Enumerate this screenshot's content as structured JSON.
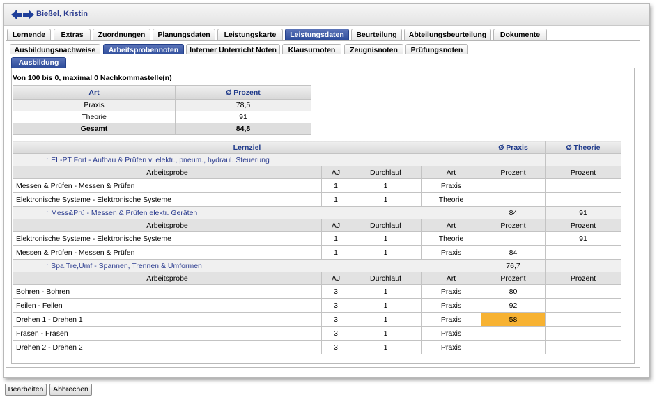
{
  "window": {
    "title": "Bießel, Kristin"
  },
  "tabs_main": [
    {
      "label": "Lernende",
      "active": false
    },
    {
      "label": "Extras",
      "active": false
    },
    {
      "label": "Zuordnungen",
      "active": false
    },
    {
      "label": "Planungsdaten",
      "active": false
    },
    {
      "label": "Leistungskarte",
      "active": false
    },
    {
      "label": "Leistungsdaten",
      "active": true
    },
    {
      "label": "Beurteilung",
      "active": false
    },
    {
      "label": "Abteilungsbeurteilung",
      "active": false
    },
    {
      "label": "Dokumente",
      "active": false
    }
  ],
  "tabs_sub": [
    {
      "label": "Ausbildungsnachweise",
      "active": false
    },
    {
      "label": "Arbeitsprobennoten",
      "active": true
    },
    {
      "label": "Interner Unterricht Noten",
      "active": false
    },
    {
      "label": "Klausurnoten",
      "active": false
    },
    {
      "label": "Zeugnisnoten",
      "active": false
    },
    {
      "label": "Prüfungsnoten",
      "active": false
    }
  ],
  "subsection_tab": "Ausbildung",
  "info_text": "Von 100 bis 0, maximal 0 Nachkommastelle(n)",
  "summary": {
    "headers": [
      "Art",
      "Ø Prozent"
    ],
    "rows": [
      {
        "art": "Praxis",
        "value": "78,5"
      },
      {
        "art": "Theorie",
        "value": "91"
      }
    ],
    "total": {
      "art": "Gesamt",
      "value": "84,8"
    }
  },
  "main": {
    "headers": {
      "lernziel": "Lernziel",
      "praxis": "Ø Praxis",
      "theorie": "Ø Theorie"
    },
    "sub_headers": {
      "arbeitsprobe": "Arbeitsprobe",
      "aj": "AJ",
      "durchlauf": "Durchlauf",
      "art": "Art",
      "prozent": "Prozent"
    },
    "groups": [
      {
        "label": "↑ EL-PT Fort - Aufbau & Prüfen v. elektr., pneum., hydraul. Steuerung",
        "avg_praxis": "",
        "avg_theorie": "",
        "sub_theorie": "Prozent",
        "rows": [
          {
            "name": "Messen & Prüfen - Messen & Prüfen",
            "aj": "1",
            "durchlauf": "1",
            "art": "Praxis",
            "praxis": "",
            "theorie": ""
          },
          {
            "name": "Elektronische Systeme - Elektronische Systeme",
            "aj": "1",
            "durchlauf": "1",
            "art": "Theorie",
            "praxis": "",
            "theorie": ""
          }
        ]
      },
      {
        "label": "↑ Mess&Prü - Messen & Prüfen elektr. Geräten",
        "avg_praxis": "84",
        "avg_theorie": "91",
        "sub_theorie": "Prozent",
        "rows": [
          {
            "name": "Elektronische Systeme - Elektronische Systeme",
            "aj": "1",
            "durchlauf": "1",
            "art": "Theorie",
            "praxis": "",
            "theorie": "91"
          },
          {
            "name": "Messen & Prüfen - Messen & Prüfen",
            "aj": "1",
            "durchlauf": "1",
            "art": "Praxis",
            "praxis": "84",
            "theorie": ""
          }
        ]
      },
      {
        "label": "↑ Spa,Tre,Umf - Spannen, Trennen & Umformen",
        "avg_praxis": "76,7",
        "avg_theorie": "",
        "sub_theorie": "Prozent",
        "rows": [
          {
            "name": "Bohren - Bohren",
            "aj": "3",
            "durchlauf": "1",
            "art": "Praxis",
            "praxis": "80",
            "theorie": ""
          },
          {
            "name": "Feilen - Feilen",
            "aj": "3",
            "durchlauf": "1",
            "art": "Praxis",
            "praxis": "92",
            "theorie": ""
          },
          {
            "name": "Drehen 1 - Drehen 1",
            "aj": "3",
            "durchlauf": "1",
            "art": "Praxis",
            "praxis": "58",
            "theorie": "",
            "highlight": true
          },
          {
            "name": "Fräsen - Fräsen",
            "aj": "3",
            "durchlauf": "1",
            "art": "Praxis",
            "praxis": "",
            "theorie": ""
          },
          {
            "name": "Drehen 2 - Drehen 2",
            "aj": "3",
            "durchlauf": "1",
            "art": "Praxis",
            "praxis": "",
            "theorie": ""
          }
        ]
      }
    ]
  },
  "buttons": {
    "edit": "Bearbeiten",
    "cancel": "Abbrechen"
  },
  "colors": {
    "active_tab": "#2b4a99",
    "highlight": "#f7b232",
    "header_text": "#1f3a8a"
  }
}
